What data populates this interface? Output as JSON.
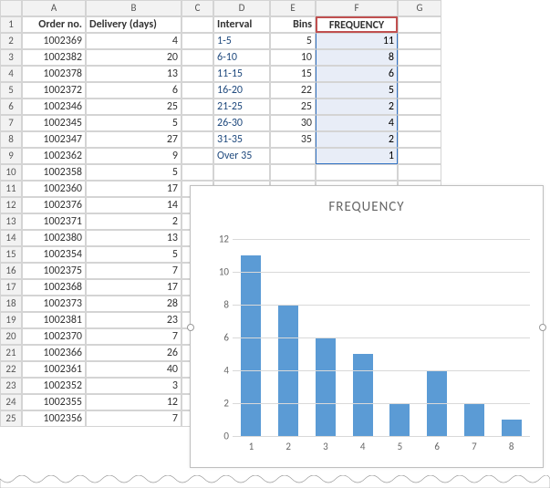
{
  "columns": [
    "",
    "A",
    "B",
    "C",
    "D",
    "E",
    "F",
    "G"
  ],
  "headers": {
    "A": "Order no.",
    "B": "Delivery (days)",
    "D": "Interval",
    "E": "Bins",
    "F": "FREQUENCY"
  },
  "orders": [
    {
      "no": "1002369",
      "d": 4
    },
    {
      "no": "1002382",
      "d": 20
    },
    {
      "no": "1002378",
      "d": 13
    },
    {
      "no": "1002372",
      "d": 6
    },
    {
      "no": "1002346",
      "d": 25
    },
    {
      "no": "1002345",
      "d": 5
    },
    {
      "no": "1002347",
      "d": 27
    },
    {
      "no": "1002362",
      "d": 9
    },
    {
      "no": "1002358",
      "d": 5
    },
    {
      "no": "1002360",
      "d": 17
    },
    {
      "no": "1002376",
      "d": 14
    },
    {
      "no": "1002371",
      "d": 2
    },
    {
      "no": "1002380",
      "d": 13
    },
    {
      "no": "1002354",
      "d": 5
    },
    {
      "no": "1002375",
      "d": 7
    },
    {
      "no": "1002368",
      "d": 17
    },
    {
      "no": "1002373",
      "d": 28
    },
    {
      "no": "1002381",
      "d": 23
    },
    {
      "no": "1002370",
      "d": 7
    },
    {
      "no": "1002366",
      "d": 26
    },
    {
      "no": "1002361",
      "d": 40
    },
    {
      "no": "1002352",
      "d": 3
    },
    {
      "no": "1002355",
      "d": 12
    },
    {
      "no": "1002356",
      "d": 7
    }
  ],
  "freq_table": [
    {
      "interval": "1-5",
      "bin": 5,
      "freq": 11
    },
    {
      "interval": "6-10",
      "bin": 10,
      "freq": 8
    },
    {
      "interval": "11-15",
      "bin": 15,
      "freq": 6
    },
    {
      "interval": "16-20",
      "bin": 22,
      "freq": 5
    },
    {
      "interval": "21-25",
      "bin": 25,
      "freq": 2
    },
    {
      "interval": "26-30",
      "bin": 30,
      "freq": 4
    },
    {
      "interval": "31-35",
      "bin": 35,
      "freq": 2
    },
    {
      "interval": "Over 35",
      "bin": "",
      "freq": 1
    }
  ],
  "chart_data": {
    "type": "bar",
    "title": "FREQUENCY",
    "categories": [
      "1",
      "2",
      "3",
      "4",
      "5",
      "6",
      "7",
      "8"
    ],
    "values": [
      11,
      8,
      6,
      5,
      2,
      4,
      2,
      1
    ],
    "ylim": [
      0,
      12
    ],
    "yticks": [
      0,
      2,
      4,
      6,
      8,
      10,
      12
    ],
    "xlabel": "",
    "ylabel": ""
  }
}
